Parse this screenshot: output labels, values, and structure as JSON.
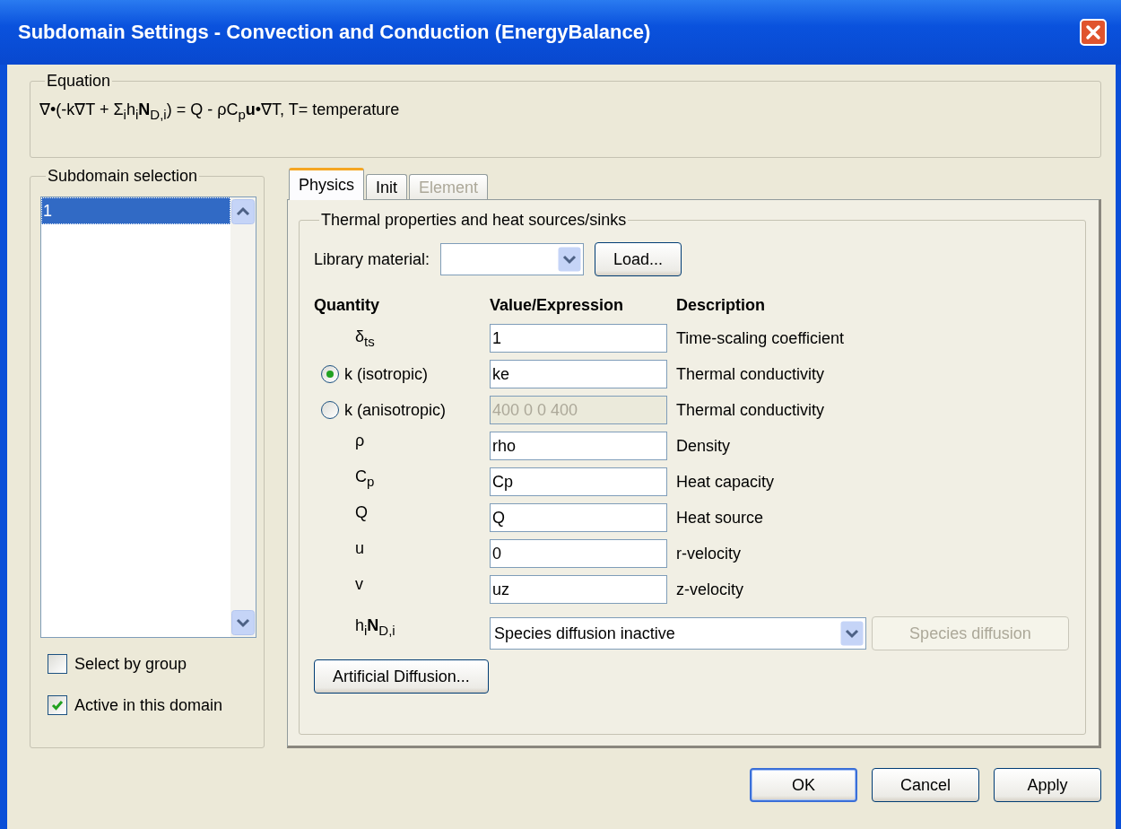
{
  "window": {
    "title": "Subdomain Settings - Convection and Conduction (EnergyBalance)"
  },
  "equation": {
    "legend": "Equation",
    "text": "∇•(-k∇T + Σ$_{i}$h$_{i}$**N**$_{D,i}$) = Q - ρC$_{p}$**u**•∇T, T= temperature"
  },
  "subdomain_selection": {
    "legend": "Subdomain selection",
    "items": [
      {
        "label": "1",
        "selected": true
      }
    ],
    "checkboxes": [
      {
        "label": "Select by group",
        "checked": false
      },
      {
        "label": "Active in this domain",
        "checked": true
      }
    ]
  },
  "tabs": [
    {
      "label": "Physics",
      "selected": true,
      "disabled": false
    },
    {
      "label": "Init",
      "selected": false,
      "disabled": false
    },
    {
      "label": "Element",
      "selected": false,
      "disabled": true
    }
  ],
  "group": {
    "legend": "Thermal properties and heat sources/sinks",
    "library_label": "Library material:",
    "load_button": "Load...",
    "headers": [
      "Quantity",
      "Value/Expression",
      "Description"
    ],
    "rows": [
      {
        "kind": "plain",
        "quantity": "δ$_{ts}$",
        "value": "1",
        "description": "Time-scaling coefficient"
      },
      {
        "kind": "radio",
        "quantity": "k (isotropic)",
        "selected": true,
        "value": "ke",
        "disabled": false,
        "description": "Thermal conductivity"
      },
      {
        "kind": "radio",
        "quantity": "k (anisotropic)",
        "selected": false,
        "value": "400 0 0 400",
        "disabled": true,
        "description": "Thermal conductivity"
      },
      {
        "kind": "plain",
        "quantity": "ρ",
        "value": "rho",
        "description": "Density"
      },
      {
        "kind": "plain",
        "quantity": "C$_{p}$",
        "value": "Cp",
        "description": "Heat capacity"
      },
      {
        "kind": "plain",
        "quantity": "Q",
        "value": "Q",
        "description": "Heat source"
      },
      {
        "kind": "plain",
        "quantity": "u",
        "value": "0",
        "description": "r-velocity"
      },
      {
        "kind": "plain",
        "quantity": "v",
        "value": "uz",
        "description": "z-velocity"
      },
      {
        "kind": "select",
        "quantity": "h$_{i}$**N**$_{D,i}$",
        "value": "Species diffusion inactive",
        "button": {
          "label": "Species diffusion",
          "disabled": true
        }
      }
    ],
    "artificial_button": "Artificial Diffusion..."
  },
  "buttons": [
    {
      "label": "OK",
      "default": true
    },
    {
      "label": "Cancel",
      "default": false
    },
    {
      "label": "Apply",
      "default": false
    }
  ]
}
